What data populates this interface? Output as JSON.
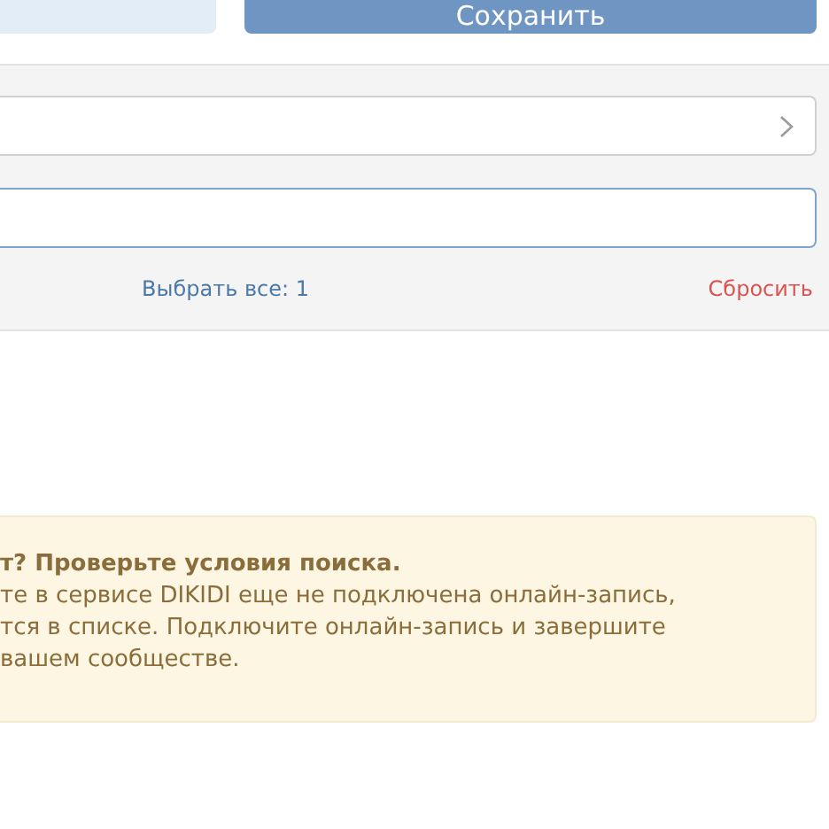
{
  "top_buttons": [
    {
      "kind": "secondary"
    },
    {
      "kind": "primary",
      "label": "Сохранить"
    }
  ],
  "filter": {
    "select_all": "Выбрать все: 1",
    "reset": "Сбросить"
  },
  "notice": {
    "title": "т? Проверьте условия поиска.",
    "lines": [
      "те в сервисе DIKIDI еще не подключена онлайн-запись,",
      "тся в списке. Подключите онлайн-запись и завершите",
      "вашем сообществе."
    ]
  }
}
